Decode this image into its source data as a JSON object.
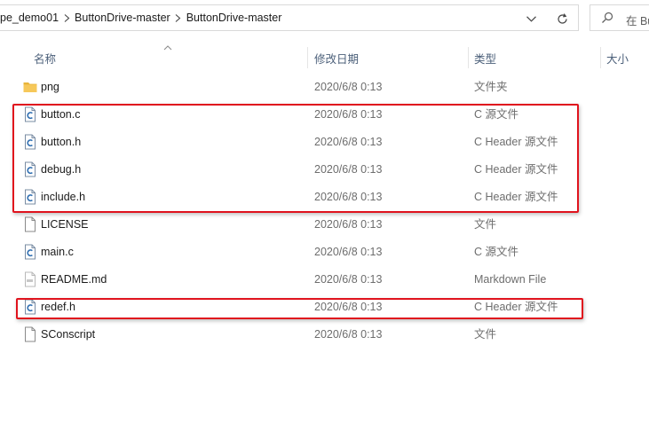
{
  "breadcrumb": {
    "items": [
      "pe_demo01",
      "ButtonDrive-master",
      "ButtonDrive-master"
    ]
  },
  "search": {
    "text": "在 Bu"
  },
  "columns": {
    "name": "名称",
    "date": "修改日期",
    "type": "类型",
    "size": "大小"
  },
  "files": [
    {
      "name": "png",
      "date": "2020/6/8 0:13",
      "type": "文件夹",
      "icon": "folder-icon"
    },
    {
      "name": "button.c",
      "date": "2020/6/8 0:13",
      "type": "C 源文件",
      "icon": "c-source-file-icon"
    },
    {
      "name": "button.h",
      "date": "2020/6/8 0:13",
      "type": "C Header 源文件",
      "icon": "c-header-file-icon"
    },
    {
      "name": "debug.h",
      "date": "2020/6/8 0:13",
      "type": "C Header 源文件",
      "icon": "c-header-file-icon"
    },
    {
      "name": "include.h",
      "date": "2020/6/8 0:13",
      "type": "C Header 源文件",
      "icon": "c-header-file-icon"
    },
    {
      "name": "LICENSE",
      "date": "2020/6/8 0:13",
      "type": "文件",
      "icon": "blank-file-icon"
    },
    {
      "name": "main.c",
      "date": "2020/6/8 0:13",
      "type": "C 源文件",
      "icon": "c-source-file-icon"
    },
    {
      "name": "README.md",
      "date": "2020/6/8 0:13",
      "type": "Markdown File",
      "icon": "markdown-file-icon"
    },
    {
      "name": "redef.h",
      "date": "2020/6/8 0:13",
      "type": "C Header 源文件",
      "icon": "c-header-file-icon"
    },
    {
      "name": "SConscript",
      "date": "2020/6/8 0:13",
      "type": "文件",
      "icon": "blank-file-icon"
    }
  ],
  "colors": {
    "highlight": "#e0131d",
    "folder": "#f2c14e",
    "header_text": "#4c607a"
  }
}
